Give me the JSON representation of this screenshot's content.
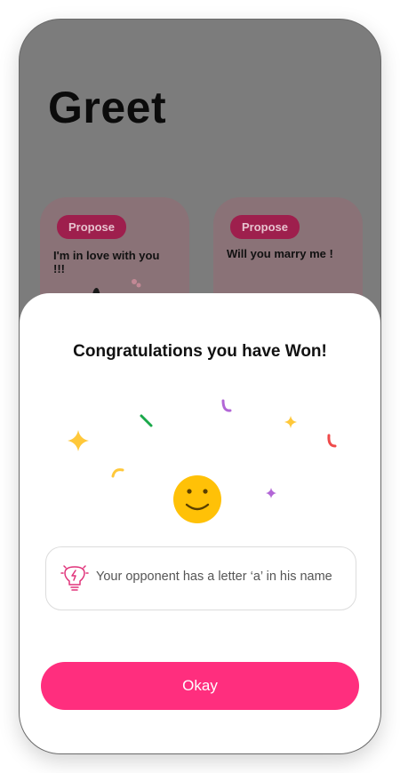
{
  "background_screen": {
    "title": "Greet",
    "cards": [
      {
        "tag": "Propose",
        "text": "I'm in love with you !!!"
      },
      {
        "tag": "Propose",
        "text": "Will you marry me !"
      }
    ]
  },
  "dialog": {
    "title": "Congratulations you have Won!",
    "emoji_icon": "smiley-face-icon",
    "hint": {
      "icon": "lightbulb-icon",
      "text": "Your opponent has a letter ‘a’ in his name"
    },
    "confirm_label": "Okay"
  },
  "colors": {
    "accent": "#ff2e7e",
    "overlay": "#7c7c7c",
    "emoji": "#ffc107",
    "confetti": [
      "#ffca28",
      "#1aa84a",
      "#b266d6",
      "#ef4a4a"
    ]
  }
}
